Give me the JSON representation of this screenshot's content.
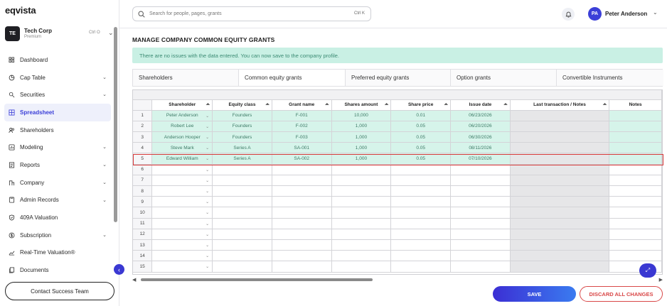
{
  "app": {
    "logo": "eqvista"
  },
  "company": {
    "initials": "TE",
    "name": "Tech Corp",
    "plan": "Premium",
    "shortcut": "Ctrl O"
  },
  "sidebar": {
    "items": [
      {
        "label": "Dashboard",
        "icon": "dashboard-icon",
        "chevron": false,
        "active": false
      },
      {
        "label": "Cap Table",
        "icon": "pie-chart-icon",
        "chevron": true,
        "active": false
      },
      {
        "label": "Securities",
        "icon": "securities-icon",
        "chevron": true,
        "active": false
      },
      {
        "label": "Spreadsheet",
        "icon": "grid-icon",
        "chevron": false,
        "active": true
      },
      {
        "label": "Shareholders",
        "icon": "users-icon",
        "chevron": false,
        "active": false
      },
      {
        "label": "Modeling",
        "icon": "modeling-icon",
        "chevron": true,
        "active": false
      },
      {
        "label": "Reports",
        "icon": "reports-icon",
        "chevron": true,
        "active": false
      },
      {
        "label": "Company",
        "icon": "company-icon",
        "chevron": true,
        "active": false
      },
      {
        "label": "Admin Records",
        "icon": "admin-icon",
        "chevron": true,
        "active": false
      },
      {
        "label": "409A Valuation",
        "icon": "shield-check-icon",
        "chevron": false,
        "active": false
      },
      {
        "label": "Subscription",
        "icon": "dollar-circle-icon",
        "chevron": true,
        "active": false
      },
      {
        "label": "Real-Time Valuation®",
        "icon": "trend-icon",
        "chevron": false,
        "active": false
      },
      {
        "label": "Documents",
        "icon": "documents-icon",
        "chevron": false,
        "active": false
      }
    ],
    "contact_label": "Contact Success Team"
  },
  "search": {
    "placeholder": "Search for people, pages, grants",
    "shortcut": "Ctrl K"
  },
  "user": {
    "initials": "PA",
    "name": "Peter Anderson"
  },
  "page": {
    "title": "MANAGE COMPANY COMMON EQUITY GRANTS",
    "notice": "There are no issues with the data entered. You can now save to the company profile."
  },
  "tabs": [
    {
      "label": "Shareholders",
      "active": false
    },
    {
      "label": "Common equity grants",
      "active": true
    },
    {
      "label": "Preferred equity grants",
      "active": false
    },
    {
      "label": "Option grants",
      "active": false
    },
    {
      "label": "Convertible Instruments",
      "active": false
    }
  ],
  "grid": {
    "columns": [
      "Shareholder",
      "Equity class",
      "Grant name",
      "Shares amount",
      "Share price",
      "Issue date",
      "Last transaction / Notes",
      "Notes"
    ],
    "rows": [
      [
        "1",
        "Peter Anderson",
        "Founders",
        "F-001",
        "10,000",
        "0.01",
        "06/23/2026",
        "",
        ""
      ],
      [
        "2",
        "Robert Lee",
        "Founders",
        "F-002",
        "1,000",
        "0.05",
        "06/20/2026",
        "",
        ""
      ],
      [
        "3",
        "Anderson Hooper",
        "Founders",
        "F-003",
        "1,000",
        "0.05",
        "06/30/2026",
        "",
        ""
      ],
      [
        "4",
        "Steve Mark",
        "Series A",
        "SA-001",
        "1,000",
        "0.05",
        "08/11/2026",
        "",
        ""
      ],
      [
        "5",
        "Edward William",
        "Series A",
        "SA-002",
        "1,000",
        "0.05",
        "07/10/2026",
        "",
        ""
      ],
      [
        "6",
        "",
        "",
        "",
        "",
        "",
        "",
        "",
        ""
      ],
      [
        "7",
        "",
        "",
        "",
        "",
        "",
        "",
        "",
        ""
      ],
      [
        "8",
        "",
        "",
        "",
        "",
        "",
        "",
        "",
        ""
      ],
      [
        "9",
        "",
        "",
        "",
        "",
        "",
        "",
        "",
        ""
      ],
      [
        "10",
        "",
        "",
        "",
        "",
        "",
        "",
        "",
        ""
      ],
      [
        "11",
        "",
        "",
        "",
        "",
        "",
        "",
        "",
        ""
      ],
      [
        "12",
        "",
        "",
        "",
        "",
        "",
        "",
        "",
        ""
      ],
      [
        "13",
        "",
        "",
        "",
        "",
        "",
        "",
        "",
        ""
      ],
      [
        "14",
        "",
        "",
        "",
        "",
        "",
        "",
        "",
        ""
      ],
      [
        "15",
        "",
        "",
        "",
        "",
        "",
        "",
        "",
        ""
      ]
    ],
    "filled_rows": 5,
    "highlighted_row": 5
  },
  "actions": {
    "save": "SAVE",
    "discard": "DISCARD ALL CHANGES"
  },
  "colors": {
    "accent": "#3b3fd8",
    "success_bg": "#c9f0e4",
    "danger": "#d94848"
  }
}
